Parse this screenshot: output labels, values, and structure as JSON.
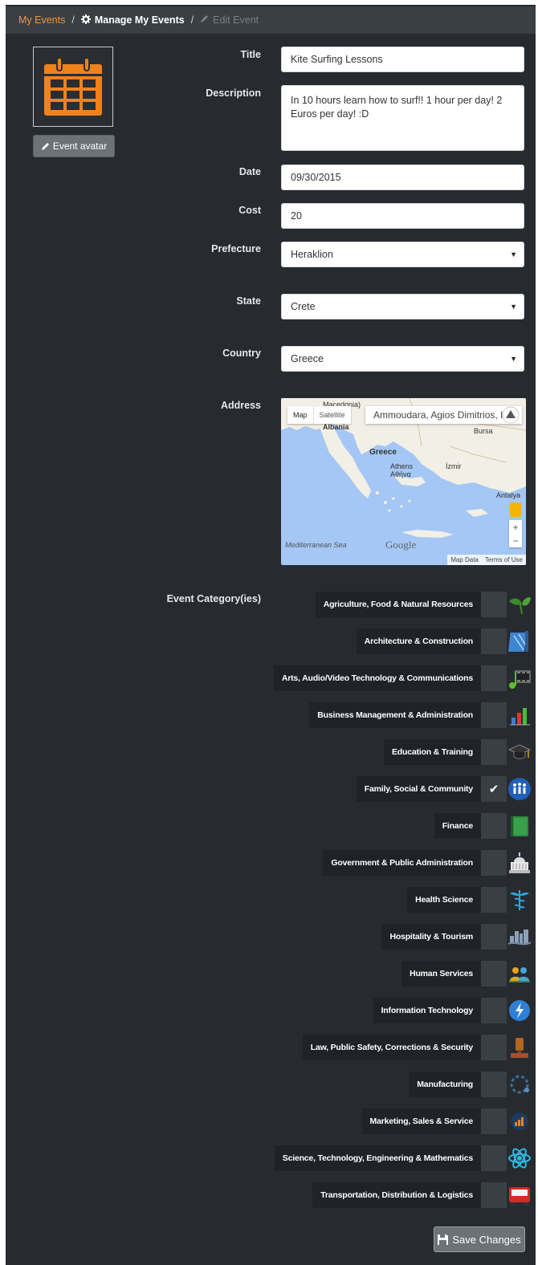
{
  "breadcrumb": {
    "home": "My Events",
    "sep": "/",
    "manage": "Manage My Events",
    "current": "Edit Event"
  },
  "avatar": {
    "button_label": "Event avatar",
    "icon": "calendar-icon",
    "icon_color": "#f0821e"
  },
  "form": {
    "title_label": "Title",
    "title_value": "Kite Surfing Lessons",
    "description_label": "Description",
    "description_value": "In 10 hours learn how to surf!! 1 hour per day! 2 Euros per day! :D",
    "date_label": "Date",
    "date_value": "09/30/2015",
    "cost_label": "Cost",
    "cost_value": "20",
    "prefecture_label": "Prefecture",
    "prefecture_value": "Heraklion",
    "state_label": "State",
    "state_value": "Crete",
    "country_label": "Country",
    "country_value": "Greece",
    "address_label": "Address",
    "category_label": "Event Category(ies)"
  },
  "map": {
    "btn_map": "Map",
    "btn_satellite": "Satellite",
    "search_value": "Ammoudara, Agios Dimitrios, Ira",
    "labels": {
      "macedonia": "Macedonia)",
      "albania": "Albania",
      "greece": "Greece",
      "athens": "Athens",
      "athens_gr": "Αθήνα",
      "izmir": "İzmir",
      "bursa": "Bursa",
      "antalya": "Antalya",
      "sea": "Mediterranean Sea",
      "google": "Google"
    },
    "zoom_in": "+",
    "zoom_out": "−",
    "footer_data": "Map Data",
    "footer_terms": "Terms of Use"
  },
  "categories": [
    {
      "label": "Agriculture, Food & Natural Resources",
      "checked": false,
      "icon": "leaf-icon"
    },
    {
      "label": "Architecture & Construction",
      "checked": false,
      "icon": "blueprint-icon"
    },
    {
      "label": "Arts, Audio/Video Technology & Communications",
      "checked": false,
      "icon": "music-film-icon"
    },
    {
      "label": "Business Management & Administration",
      "checked": false,
      "icon": "bar-chart-icon"
    },
    {
      "label": "Education & Training",
      "checked": false,
      "icon": "graduation-cap-icon"
    },
    {
      "label": "Family, Social & Community",
      "checked": true,
      "icon": "family-icon"
    },
    {
      "label": "Finance",
      "checked": false,
      "icon": "ledger-icon"
    },
    {
      "label": "Government & Public Administration",
      "checked": false,
      "icon": "capitol-icon"
    },
    {
      "label": "Health Science",
      "checked": false,
      "icon": "caduceus-icon"
    },
    {
      "label": "Hospitality & Tourism",
      "checked": false,
      "icon": "skyline-icon"
    },
    {
      "label": "Human Services",
      "checked": false,
      "icon": "people-icon"
    },
    {
      "label": "Information Technology",
      "checked": false,
      "icon": "lightning-icon"
    },
    {
      "label": "Law, Public Safety, Corrections & Security",
      "checked": false,
      "icon": "gavel-icon"
    },
    {
      "label": "Manufacturing",
      "checked": false,
      "icon": "chain-icon"
    },
    {
      "label": "Marketing, Sales & Service",
      "checked": false,
      "icon": "chart-badge-icon"
    },
    {
      "label": "Science, Technology, Engineering & Mathematics",
      "checked": false,
      "icon": "atom-icon"
    },
    {
      "label": "Transportation, Distribution & Logistics",
      "checked": false,
      "icon": "truck-icon"
    }
  ],
  "save_label": "Save Changes",
  "colors": {
    "accent": "#f0953c",
    "panel": "#272b30",
    "bar": "#3a3f44"
  }
}
